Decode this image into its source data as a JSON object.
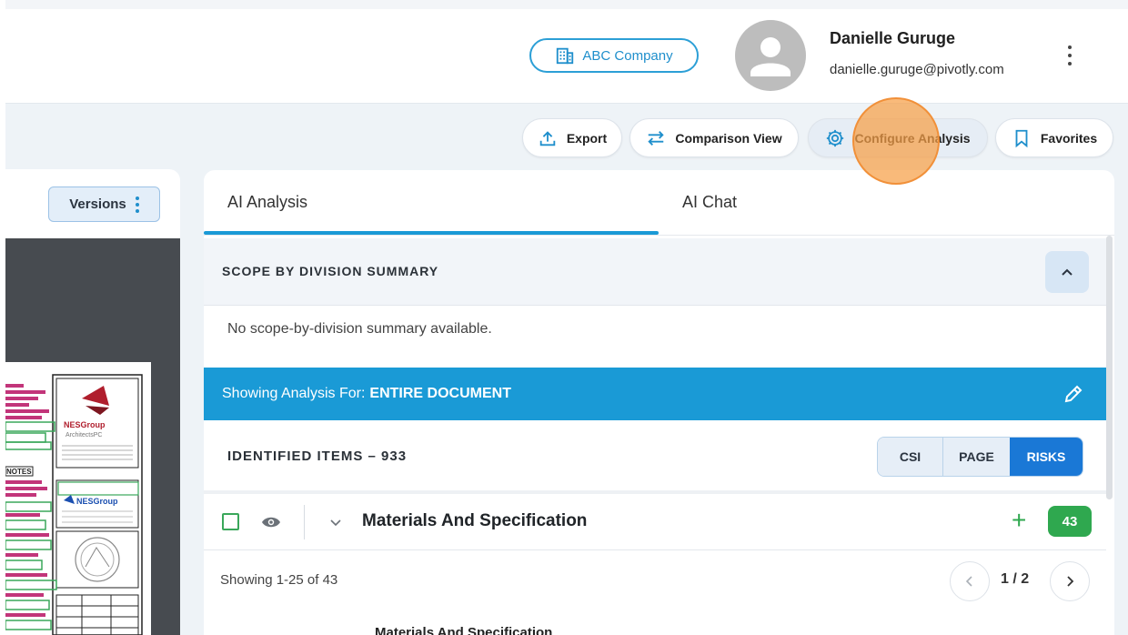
{
  "header": {
    "company": "ABC Company",
    "user_name": "Danielle Guruge",
    "user_email": "danielle.guruge@pivotly.com"
  },
  "toolbar": {
    "export": "Export",
    "comparison": "Comparison View",
    "configure": "Configure Analysis",
    "favorites": "Favorites"
  },
  "left_panel": {
    "versions": "Versions"
  },
  "doc_page": {
    "logo_text_1": "NESGroup",
    "logo_text_2": "ArchitectsPC",
    "notes": "NOTES",
    "logo2_text": "NESGroup"
  },
  "tabs": [
    {
      "label": "AI Analysis"
    },
    {
      "label": "AI Chat"
    }
  ],
  "scope": {
    "title": "SCOPE BY DIVISION SUMMARY",
    "empty": "No scope-by-division summary available."
  },
  "analysis_bar": {
    "prefix": "Showing Analysis For:",
    "target": "ENTIRE DOCUMENT"
  },
  "items": {
    "title": "IDENTIFIED ITEMS – 933",
    "segments": [
      "CSI",
      "PAGE",
      "RISKS"
    ]
  },
  "category": {
    "title": "Materials And Specification",
    "count": "43"
  },
  "pagination": {
    "showing": "Showing 1-25 of 43",
    "page": "1 / 2"
  },
  "truncated_title": "Materials And Specification",
  "colors": {
    "accent": "#1a9ad6",
    "green": "#2fa84f",
    "click_indicator": "#f7a046"
  }
}
